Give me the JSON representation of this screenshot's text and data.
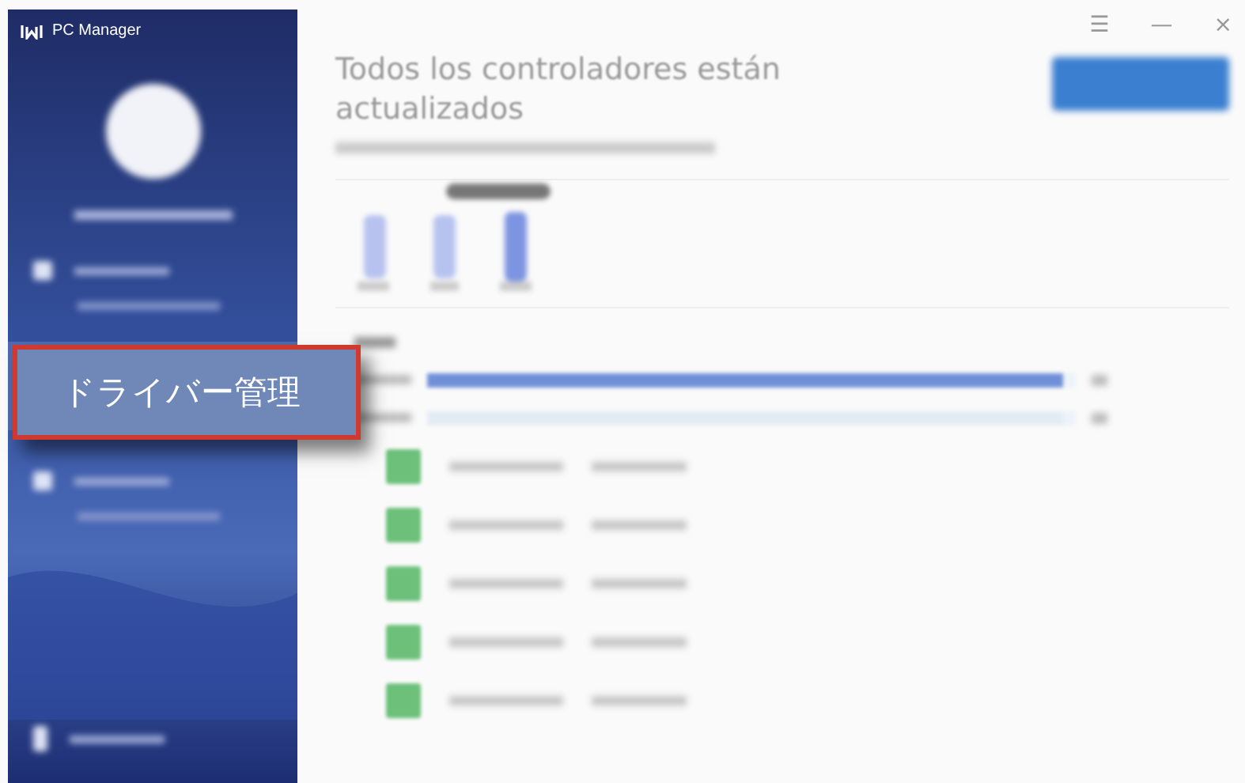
{
  "window": {
    "title": "PC Manager",
    "controls": [
      "☰",
      "—",
      "×"
    ]
  },
  "sidebar": {
    "items": [
      {
        "kind": "nav"
      },
      {
        "kind": "sub"
      },
      {
        "kind": "gap"
      },
      {
        "kind": "nav"
      },
      {
        "kind": "sub"
      },
      {
        "kind": "footer"
      }
    ]
  },
  "callout": {
    "label": "ドライバー管理"
  },
  "header": {
    "title": "Todos los controladores están actualizados"
  },
  "meters": [
    {
      "level": 0.98,
      "color": "#6f8fd8"
    },
    {
      "level": 0.98,
      "color": "#e3ecf4"
    }
  ],
  "drivers": [
    {
      "color": "#6cc07a"
    },
    {
      "color": "#6cc07a"
    },
    {
      "color": "#6cc07a"
    },
    {
      "color": "#6cc07a"
    },
    {
      "color": "#6cc07a"
    }
  ]
}
